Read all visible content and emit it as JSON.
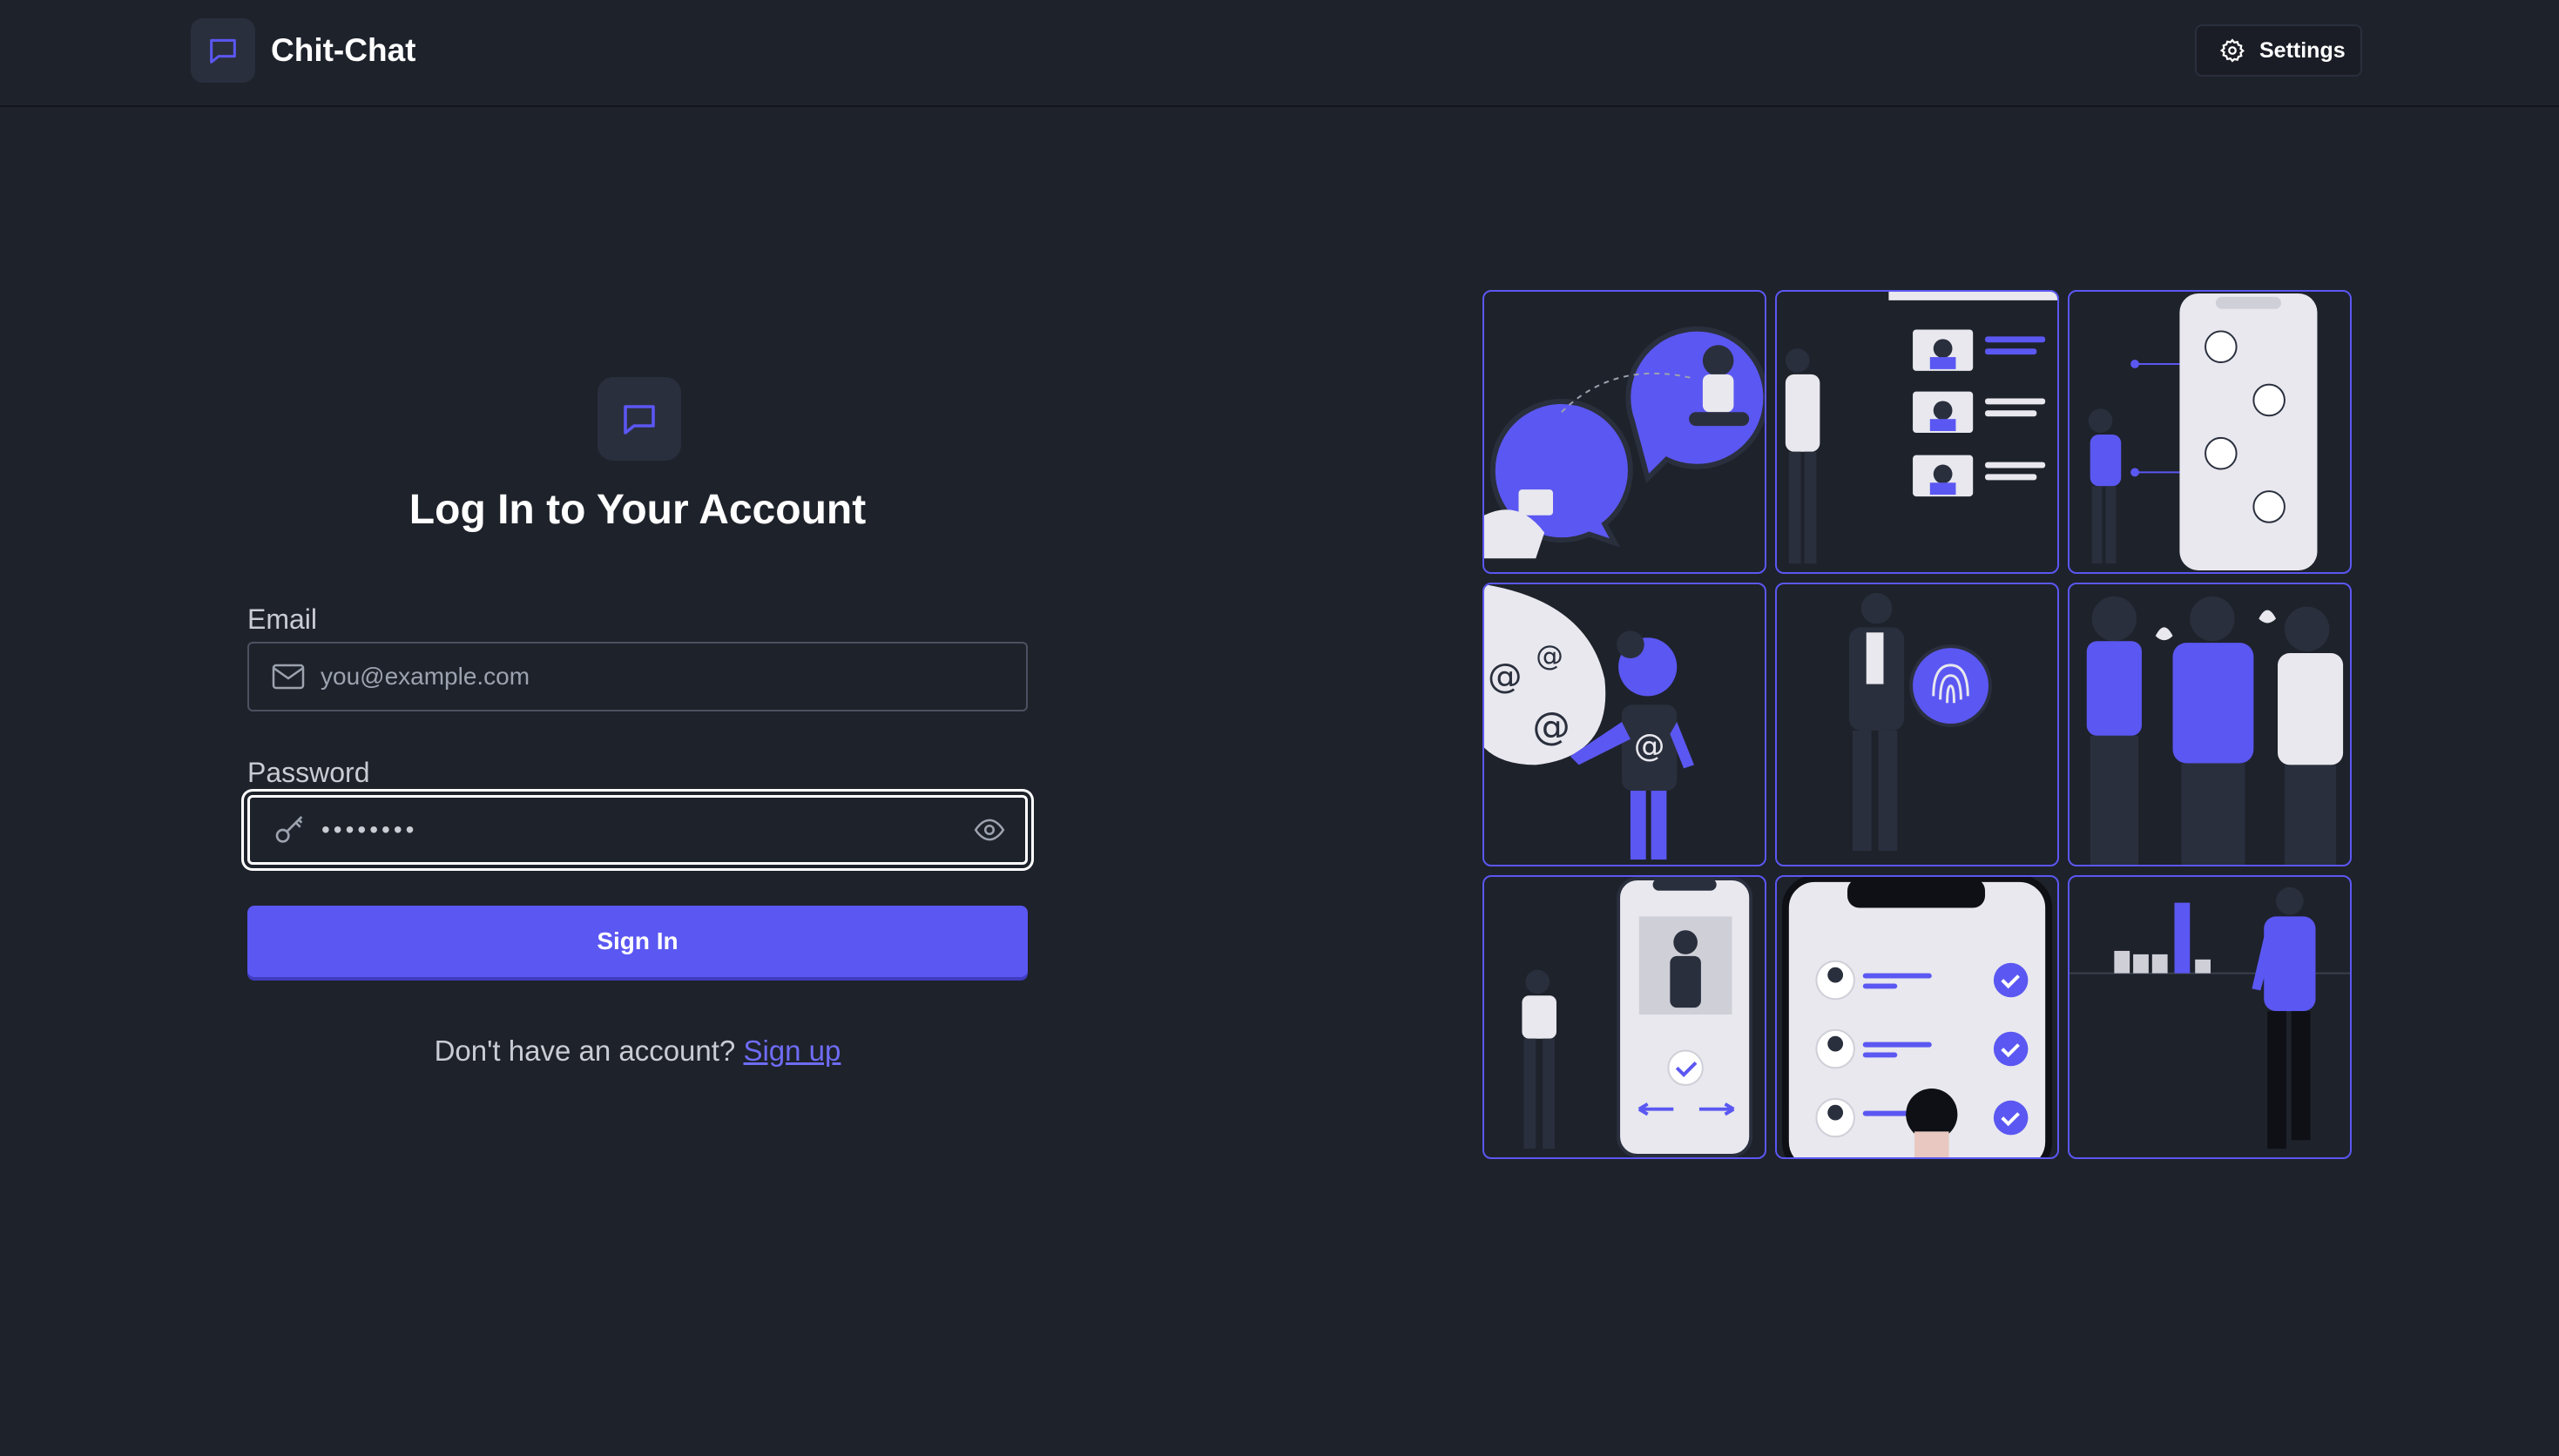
{
  "app": {
    "title": "Chit-Chat"
  },
  "header": {
    "settings_label": "Settings"
  },
  "login": {
    "title": "Log In to Your Account",
    "email": {
      "label": "Email",
      "placeholder": "you@example.com",
      "value": ""
    },
    "password": {
      "label": "Password",
      "value": "••••••••"
    },
    "submit_label": "Sign In",
    "signup_prompt": "Don't have an account?",
    "signup_link": "Sign up"
  },
  "icons": {
    "logo": "chat-bubble-icon",
    "settings": "gear-icon",
    "email": "envelope-icon",
    "password": "key-icon",
    "visibility": "eye-icon"
  },
  "colors": {
    "background": "#1e222b",
    "accent": "#5b57f2",
    "text": "#ffffff",
    "muted": "#9ca3af",
    "border": "#4b5160"
  },
  "illustrations": [
    "chat-bubbles-illustration",
    "profiles-list-illustration",
    "phone-social-illustration",
    "email-mentions-illustration",
    "fingerprint-illustration",
    "group-people-illustration",
    "phone-profile-illustration",
    "checklist-phone-illustration",
    "bar-chart-person-illustration"
  ]
}
